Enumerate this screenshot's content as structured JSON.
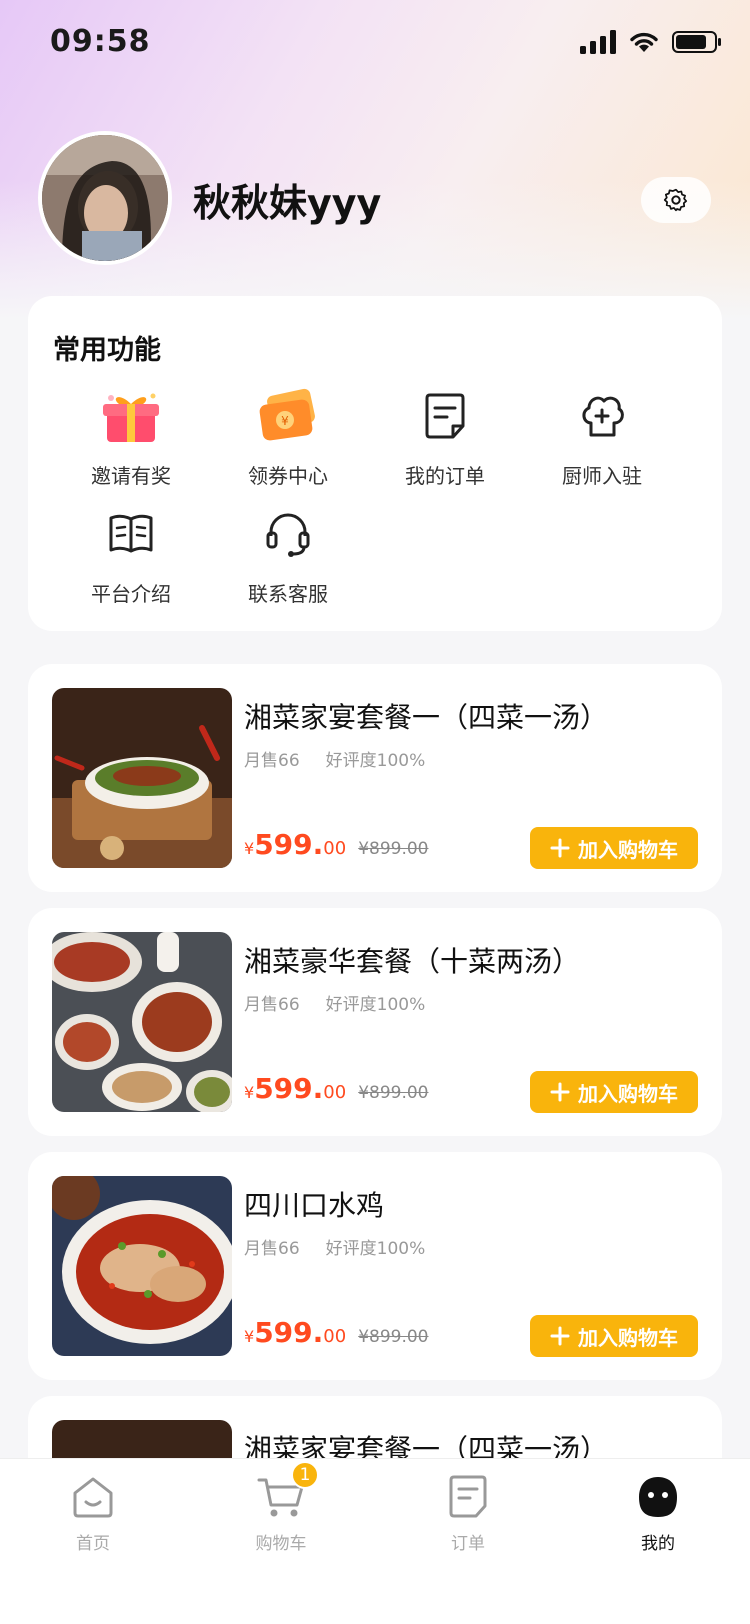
{
  "status_bar": {
    "time": "09:58"
  },
  "profile": {
    "username": "秋秋妹yyy"
  },
  "functions": {
    "title": "常用功能",
    "items": [
      {
        "label": "邀请有奖",
        "icon": "gift-icon"
      },
      {
        "label": "领券中心",
        "icon": "coupon-icon"
      },
      {
        "label": "我的订单",
        "icon": "order-icon"
      },
      {
        "label": "厨师入驻",
        "icon": "chef-hat-icon"
      },
      {
        "label": "平台介绍",
        "icon": "book-icon"
      },
      {
        "label": "联系客服",
        "icon": "headset-icon"
      }
    ]
  },
  "products": [
    {
      "name": "湘菜家宴套餐一（四菜一汤）",
      "monthly_sales": "月售66",
      "rating": "好评度100%",
      "currency": "¥",
      "price_int": "599.",
      "price_dec": "00",
      "original_price": "¥899.00",
      "add_label": "加入购物车"
    },
    {
      "name": "湘菜豪华套餐（十菜两汤）",
      "monthly_sales": "月售66",
      "rating": "好评度100%",
      "currency": "¥",
      "price_int": "599.",
      "price_dec": "00",
      "original_price": "¥899.00",
      "add_label": "加入购物车"
    },
    {
      "name": "四川口水鸡",
      "monthly_sales": "月售66",
      "rating": "好评度100%",
      "currency": "¥",
      "price_int": "599.",
      "price_dec": "00",
      "original_price": "¥899.00",
      "add_label": "加入购物车"
    },
    {
      "name": "湘菜家宴套餐一（四菜一汤）"
    }
  ],
  "tab_bar": {
    "tabs": [
      {
        "label": "首页",
        "icon": "home-icon"
      },
      {
        "label": "购物车",
        "icon": "cart-icon",
        "badge": "1"
      },
      {
        "label": "订单",
        "icon": "order-icon"
      },
      {
        "label": "我的",
        "icon": "profile-icon",
        "active": true
      }
    ]
  },
  "colors": {
    "accent": "#f9b40c",
    "price": "#ff4a1f"
  }
}
